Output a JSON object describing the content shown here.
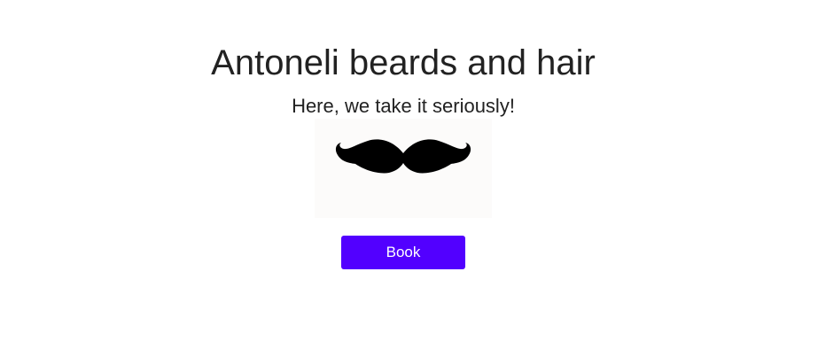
{
  "header": {
    "title": "Antoneli beards and hair",
    "tagline": "Here, we take it seriously!"
  },
  "logo": {
    "icon": "mustache-icon",
    "background_color": "#fcfbfa",
    "fill_color": "#000000"
  },
  "actions": {
    "book_label": "Book",
    "book_color": "#5200ff"
  }
}
